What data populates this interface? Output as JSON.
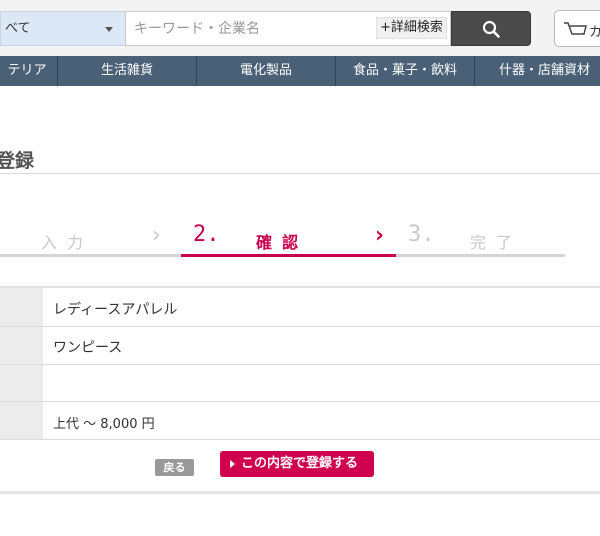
{
  "search": {
    "category_value": "べて",
    "placeholder": "キーワード・企業名",
    "advanced_label": "+詳細検索"
  },
  "cart": {
    "label": "カ"
  },
  "nav": {
    "items": [
      "テリア",
      "生活雑貨",
      "電化製品",
      "食品・菓子・飲料",
      "什器・店舗資材"
    ]
  },
  "page_title": "登録",
  "steps": {
    "step1_label": "入力",
    "step2_number": "2.",
    "step2_label": "確認",
    "step3_number": "3.",
    "step3_label": "完了",
    "chevron": "›"
  },
  "table": {
    "rows": [
      "レディースアパレル",
      "ワンピース",
      "",
      "上代 〜 8,000 円"
    ]
  },
  "actions": {
    "back_label": "戻る",
    "submit_label": "この内容で登録する"
  },
  "colors": {
    "accent": "#c8004d",
    "nav_bg": "#4a6076"
  }
}
